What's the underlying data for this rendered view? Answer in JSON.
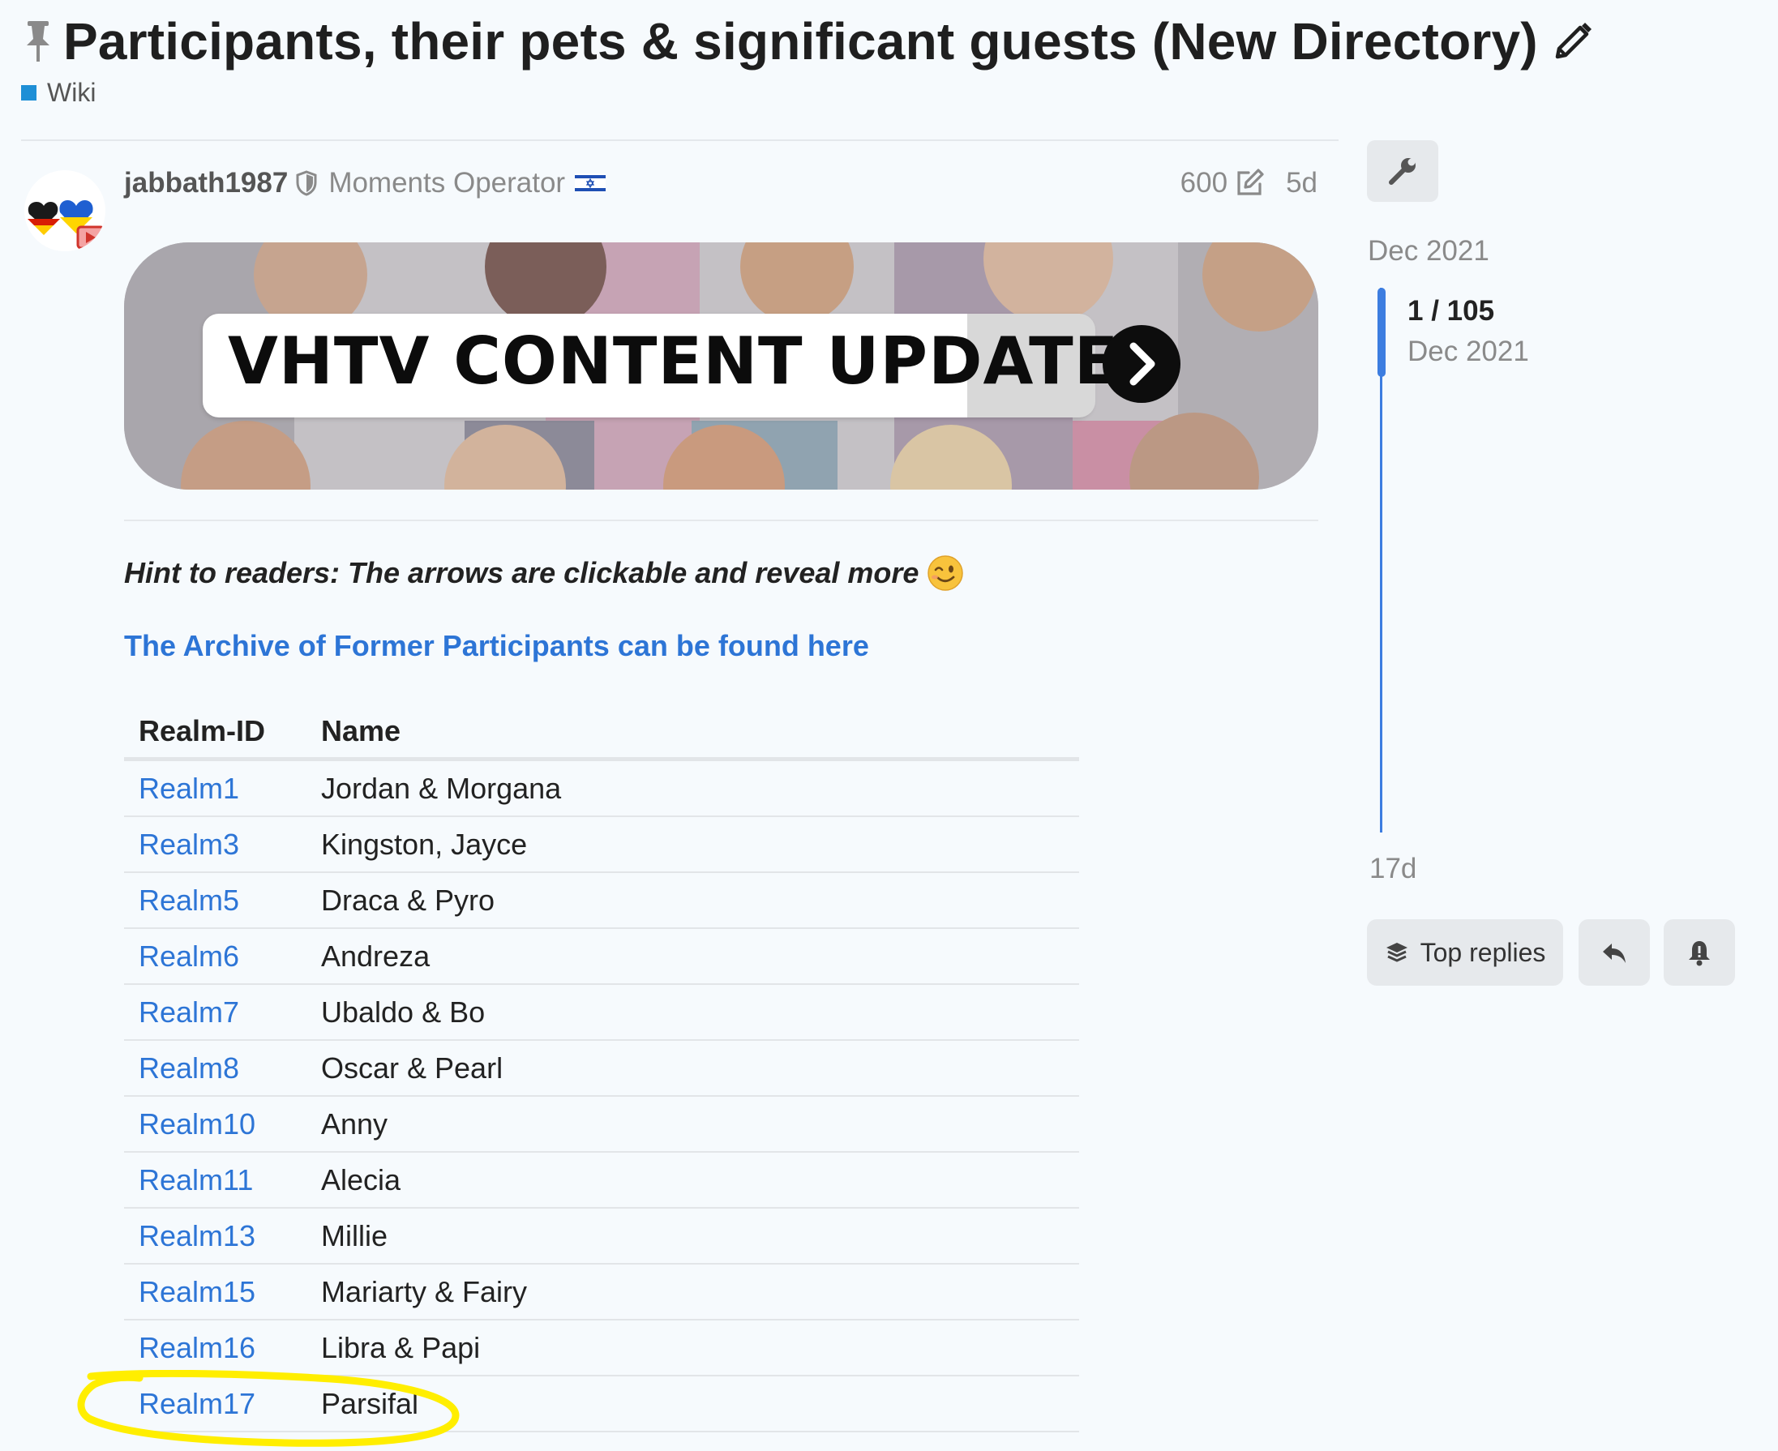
{
  "topic": {
    "title": "Participants, their pets & significant guests (New Directory)",
    "category": "Wiki",
    "category_color": "#1e8fd6"
  },
  "post": {
    "username": "jabbath1987",
    "user_title": "Moments Operator",
    "edit_count": "600",
    "age": "5d",
    "banner_text": "VHTV CONTENT UPDATES",
    "hint": "Hint to readers: The arrows are clickable and reveal more",
    "archive_link": "The Archive of Former Participants can be found here",
    "table": {
      "headers": [
        "Realm-ID",
        "Name"
      ],
      "rows": [
        {
          "realm": "Realm1",
          "name": "Jordan & Morgana"
        },
        {
          "realm": "Realm3",
          "name": "Kingston, Jayce"
        },
        {
          "realm": "Realm5",
          "name": "Draca & Pyro"
        },
        {
          "realm": "Realm6",
          "name": "Andreza"
        },
        {
          "realm": "Realm7",
          "name": "Ubaldo & Bo"
        },
        {
          "realm": "Realm8",
          "name": "Oscar & Pearl"
        },
        {
          "realm": "Realm10",
          "name": "Anny"
        },
        {
          "realm": "Realm11",
          "name": "Alecia"
        },
        {
          "realm": "Realm13",
          "name": "Millie"
        },
        {
          "realm": "Realm15",
          "name": "Mariarty & Fairy"
        },
        {
          "realm": "Realm16",
          "name": "Libra & Papi"
        },
        {
          "realm": "Realm17",
          "name": "Parsifal"
        }
      ]
    }
  },
  "timeline": {
    "start_date": "Dec 2021",
    "position": "1 / 105",
    "position_date": "Dec 2021",
    "end_date": "17d",
    "progress": 0.01
  },
  "actions": {
    "top_replies_label": "Top replies"
  },
  "colors": {
    "link": "#2d75d6",
    "timeline": "#3d7de0",
    "highlight": "#ffee00"
  }
}
